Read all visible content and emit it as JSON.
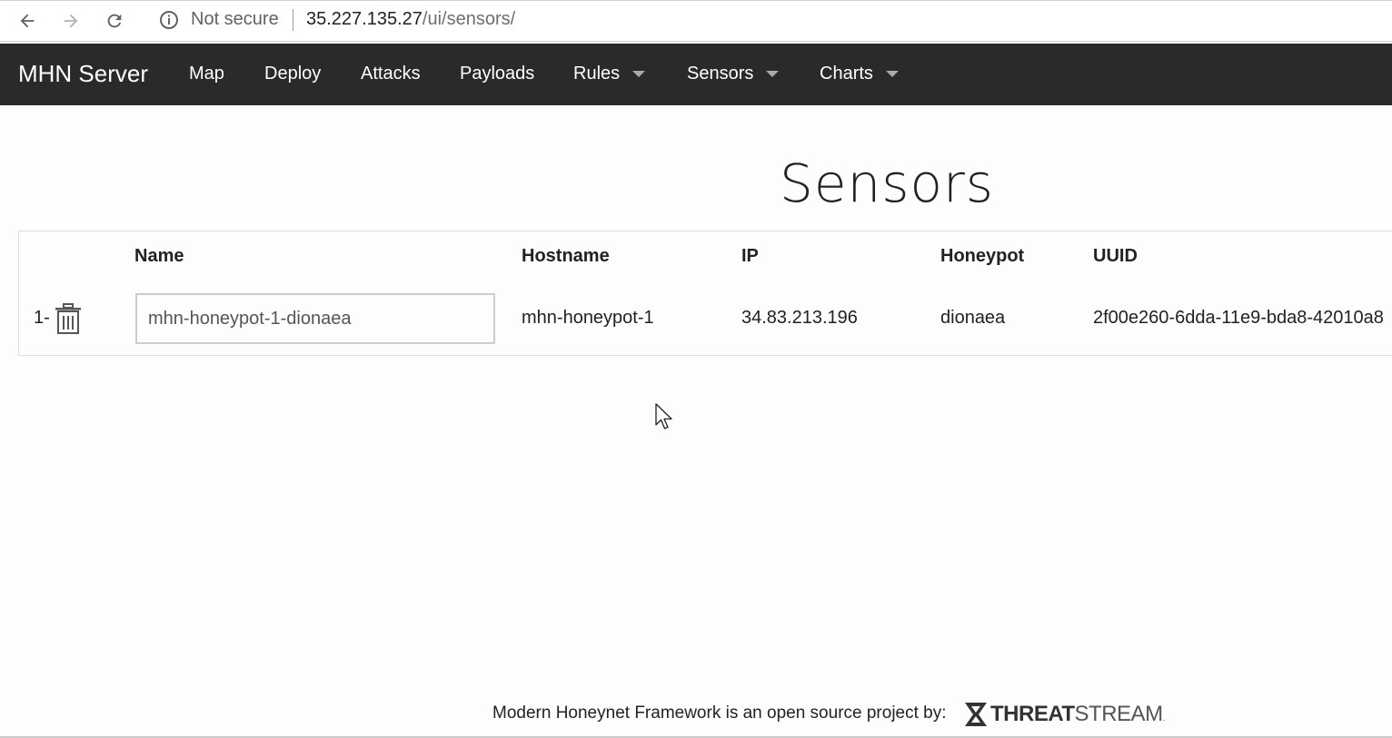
{
  "browser": {
    "security_label": "Not secure",
    "url_host": "35.227.135.27",
    "url_path": "/ui/sensors/"
  },
  "navbar": {
    "brand": "MHN Server",
    "items": [
      {
        "label": "Map",
        "dropdown": false
      },
      {
        "label": "Deploy",
        "dropdown": false
      },
      {
        "label": "Attacks",
        "dropdown": false
      },
      {
        "label": "Payloads",
        "dropdown": false
      },
      {
        "label": "Rules",
        "dropdown": true
      },
      {
        "label": "Sensors",
        "dropdown": true
      },
      {
        "label": "Charts",
        "dropdown": true
      }
    ]
  },
  "page": {
    "title": "Sensors"
  },
  "table": {
    "headers": [
      "Name",
      "Hostname",
      "IP",
      "Honeypot",
      "UUID"
    ],
    "rows": [
      {
        "index": "1-",
        "name": "mhn-honeypot-1-dionaea",
        "hostname": "mhn-honeypot-1",
        "ip": "34.83.213.196",
        "honeypot": "dionaea",
        "uuid": "2f00e260-6dda-11e9-bda8-42010a8"
      }
    ]
  },
  "footer": {
    "text": "Modern Honeynet Framework is an open source project by:",
    "logo_bold": "THREAT",
    "logo_light": "STREAM",
    "logo_suffix": "."
  },
  "icons": {
    "back": "arrow-left-icon",
    "forward": "arrow-right-icon",
    "reload": "reload-icon",
    "info": "info-icon",
    "delete": "trash-icon"
  },
  "colors": {
    "navbar_bg": "#2a2a2a",
    "navbar_text": "#ffffff"
  }
}
